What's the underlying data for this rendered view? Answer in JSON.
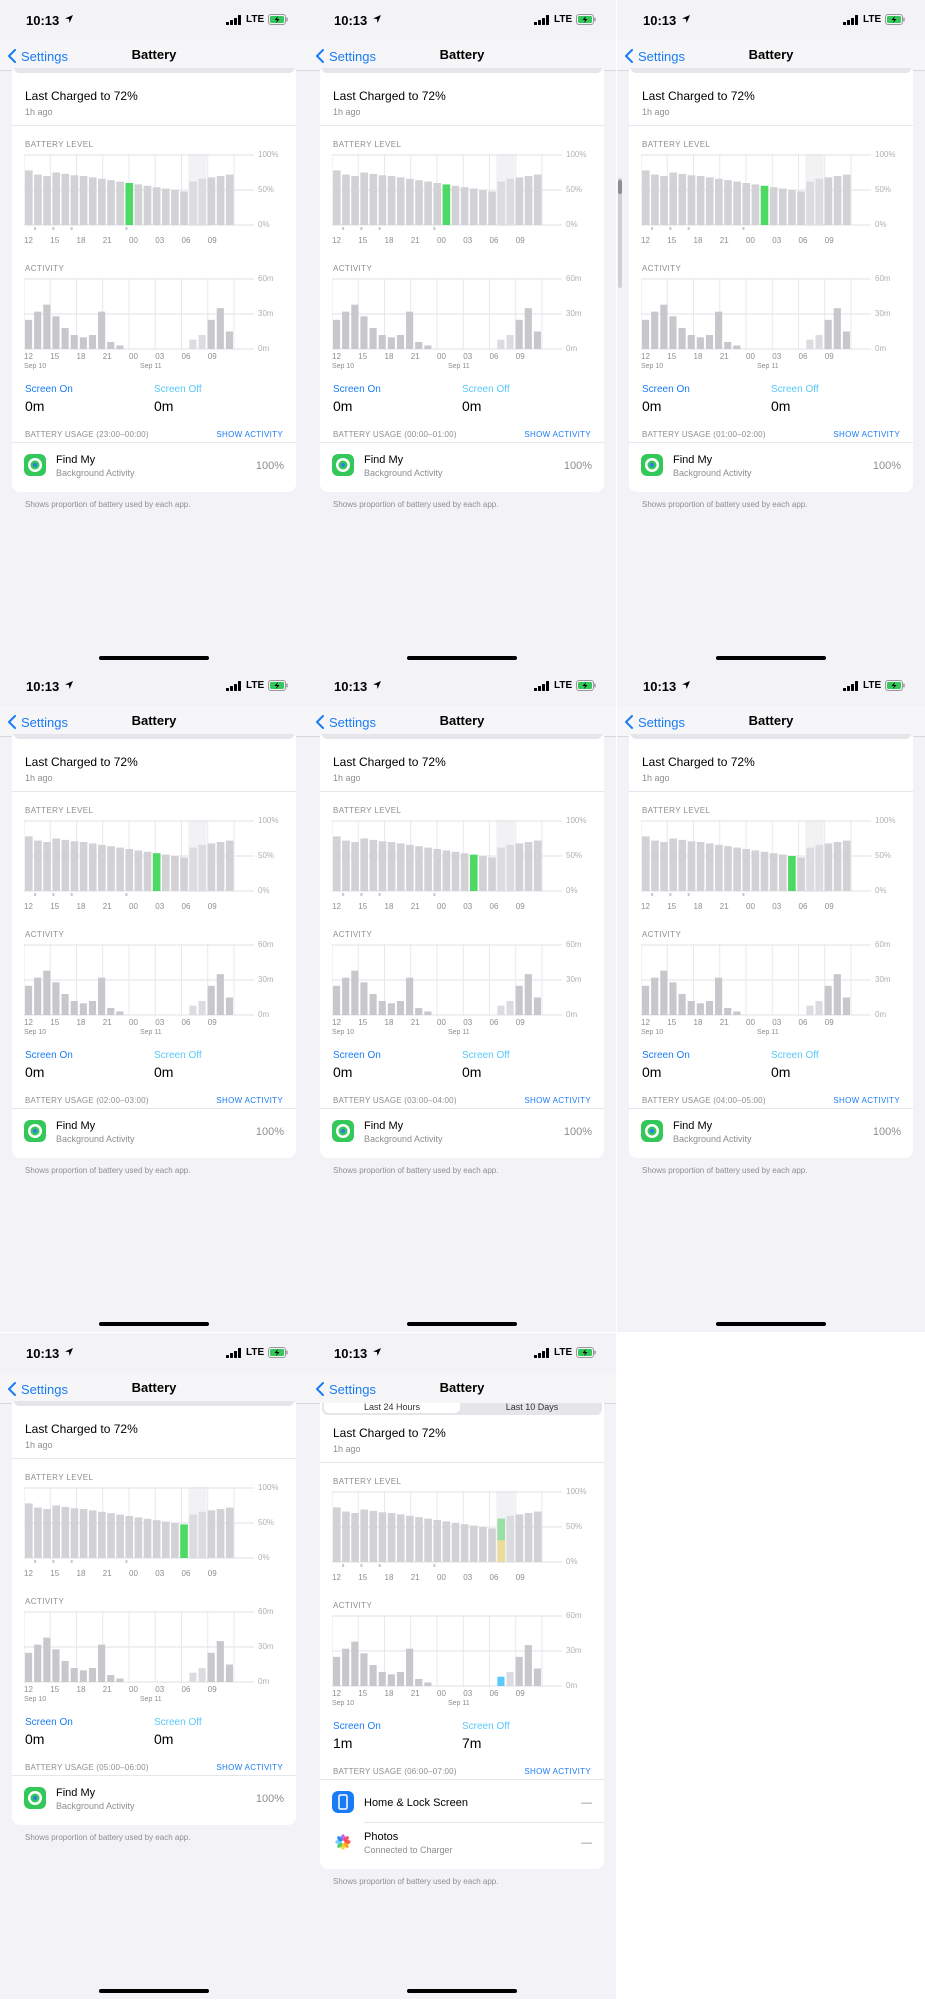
{
  "status": {
    "time": "10:13",
    "network": "LTE"
  },
  "nav": {
    "back_label": "Settings",
    "title": "Battery"
  },
  "segments": [
    "Last 24 Hours",
    "Last 10 Days"
  ],
  "last_charged": {
    "title": "Last Charged to 72%",
    "subtitle": "1h ago"
  },
  "battery_level_label": "BATTERY LEVEL",
  "activity_label": "ACTIVITY",
  "battery_y_ticks": [
    "100%",
    "50%",
    "0%"
  ],
  "activity_y_ticks": [
    "60m",
    "30m",
    "0m"
  ],
  "x_ticks": [
    "12",
    "15",
    "18",
    "21",
    "00",
    "03",
    "06",
    "09"
  ],
  "dates": [
    "Sep 10",
    "Sep 11"
  ],
  "screen_on_label": "Screen On",
  "screen_off_label": "Screen Off",
  "show_activity": "SHOW ACTIVITY",
  "footnote": "Shows proportion of battery used by each app.",
  "colors": {
    "accent": "#1a7cf5",
    "highlight": "#4cd964",
    "bar": "#c7c7cc",
    "screen_on": "#1a7cf5",
    "screen_off": "#5ac8fa"
  },
  "screens": [
    {
      "usage": "BATTERY USAGE (23:00–00:00)",
      "screen_on": "0m",
      "screen_off": "0m",
      "highlight_hour": 11,
      "apps": [
        {
          "name": "Find My",
          "sub": "Background Activity",
          "value": "100%",
          "icon": "find-my-icon"
        }
      ]
    },
    {
      "usage": "BATTERY USAGE (00:00–01:00)",
      "screen_on": "0m",
      "screen_off": "0m",
      "highlight_hour": 12,
      "apps": [
        {
          "name": "Find My",
          "sub": "Background Activity",
          "value": "100%",
          "icon": "find-my-icon"
        }
      ]
    },
    {
      "usage": "BATTERY USAGE (01:00–02:00)",
      "screen_on": "0m",
      "screen_off": "0m",
      "highlight_hour": 13,
      "apps": [
        {
          "name": "Find My",
          "sub": "Background Activity",
          "value": "100%",
          "icon": "find-my-icon"
        }
      ]
    },
    {
      "usage": "BATTERY USAGE (02:00–03:00)",
      "screen_on": "0m",
      "screen_off": "0m",
      "highlight_hour": 14,
      "apps": [
        {
          "name": "Find My",
          "sub": "Background Activity",
          "value": "100%",
          "icon": "find-my-icon"
        }
      ]
    },
    {
      "usage": "BATTERY USAGE (03:00–04:00)",
      "screen_on": "0m",
      "screen_off": "0m",
      "highlight_hour": 15,
      "apps": [
        {
          "name": "Find My",
          "sub": "Background Activity",
          "value": "100%",
          "icon": "find-my-icon"
        }
      ]
    },
    {
      "usage": "BATTERY USAGE (04:00–05:00)",
      "screen_on": "0m",
      "screen_off": "0m",
      "highlight_hour": 16,
      "apps": [
        {
          "name": "Find My",
          "sub": "Background Activity",
          "value": "100%",
          "icon": "find-my-icon"
        }
      ]
    },
    {
      "usage": "BATTERY USAGE (05:00–06:00)",
      "screen_on": "0m",
      "screen_off": "0m",
      "highlight_hour": 17,
      "apps": [
        {
          "name": "Find My",
          "sub": "Background Activity",
          "value": "100%",
          "icon": "find-my-icon"
        }
      ]
    },
    {
      "usage": "BATTERY USAGE (06:00–07:00)",
      "screen_on": "1m",
      "screen_off": "7m",
      "highlight_hour": 18,
      "apps": [
        {
          "name": "Home & Lock Screen",
          "sub": "",
          "value": "—",
          "icon": "home-lock-screen-icon"
        },
        {
          "name": "Photos",
          "sub": "Connected to Charger",
          "value": "—",
          "icon": "photos-icon"
        }
      ]
    }
  ],
  "chart_data": [
    {
      "type": "bar",
      "title": "BATTERY LEVEL",
      "categories": [
        "12",
        "13",
        "14",
        "15",
        "16",
        "17",
        "18",
        "19",
        "20",
        "21",
        "22",
        "23",
        "00",
        "01",
        "02",
        "03",
        "04",
        "05",
        "06",
        "07",
        "08",
        "09",
        "10"
      ],
      "values": [
        78,
        72,
        70,
        75,
        73,
        71,
        70,
        68,
        66,
        64,
        62,
        60,
        58,
        56,
        54,
        52,
        50,
        48,
        62,
        66,
        68,
        70,
        72
      ],
      "ylim": [
        0,
        100
      ],
      "yticks": [
        "100%",
        "50%",
        "0%"
      ]
    },
    {
      "type": "bar",
      "title": "ACTIVITY",
      "categories": [
        "12",
        "13",
        "14",
        "15",
        "16",
        "17",
        "18",
        "19",
        "20",
        "21",
        "22",
        "23",
        "00",
        "01",
        "02",
        "03",
        "04",
        "05",
        "06",
        "07",
        "08",
        "09",
        "10"
      ],
      "values": [
        25,
        32,
        38,
        28,
        18,
        12,
        10,
        12,
        32,
        6,
        3,
        0,
        0,
        0,
        0,
        0,
        0,
        0,
        8,
        12,
        25,
        35,
        15
      ],
      "ylim": [
        0,
        60
      ],
      "yticks": [
        "60m",
        "30m",
        "0m"
      ]
    }
  ]
}
